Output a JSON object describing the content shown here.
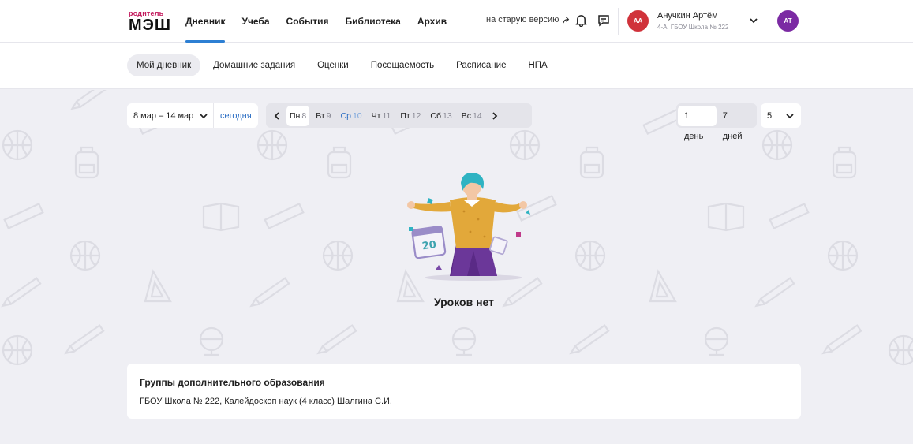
{
  "header": {
    "logo_small": "родитель",
    "logo_big": "МЭШ",
    "nav": [
      {
        "label": "Дневник",
        "active": true
      },
      {
        "label": "Учеба",
        "active": false
      },
      {
        "label": "События",
        "active": false
      },
      {
        "label": "Библиотека",
        "active": false
      },
      {
        "label": "Архив",
        "active": false
      }
    ],
    "old_version": "на старую версию",
    "profile": {
      "initials": "АА",
      "name": "Анучкин Артём",
      "sub": "4-А, ГБОУ Школа № 222",
      "avatar_color": "#d0323a"
    },
    "user_initials": "АТ",
    "user_avatar_color": "#7b2aa3"
  },
  "subnav": [
    "Мой дневник",
    "Домашние задания",
    "Оценки",
    "Посещаемость",
    "Расписание",
    "НПА"
  ],
  "controls": {
    "range": "8 мар – 14 мар",
    "today": "сегодня",
    "days": [
      {
        "name": "Пн",
        "num": "8",
        "selected": true
      },
      {
        "name": "Вт",
        "num": "9"
      },
      {
        "name": "Ср",
        "num": "10",
        "current": true
      },
      {
        "name": "Чт",
        "num": "11"
      },
      {
        "name": "Пт",
        "num": "12"
      },
      {
        "name": "Сб",
        "num": "13"
      },
      {
        "name": "Вс",
        "num": "14"
      }
    ],
    "view_options": [
      "1 день",
      "7 дней"
    ],
    "count": "5"
  },
  "empty_text": "Уроков нет",
  "groups": {
    "title": "Группы дополнительного образования",
    "text": "ГБОУ Школа № 222, Калейдоскоп наук (4 класс) Шалгина С.И."
  },
  "colors": {
    "accent": "#2d7fd3",
    "link": "#2d6fc4",
    "bg": "#efeff4"
  }
}
